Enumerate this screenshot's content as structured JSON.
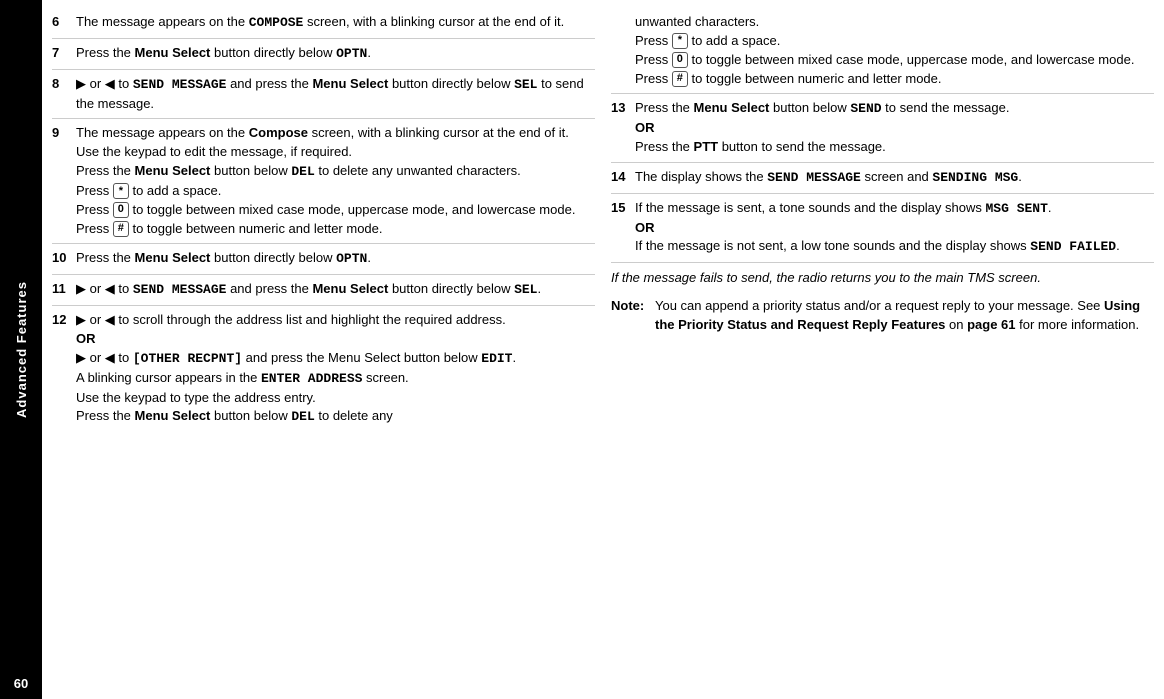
{
  "sidebar": {
    "label": "Advanced Features",
    "page_number": "60"
  },
  "left_column": {
    "steps": [
      {
        "num": "6",
        "parts": [
          {
            "type": "text",
            "content": "The message appears on the "
          },
          {
            "type": "mono",
            "content": "COMPOSE"
          },
          {
            "type": "text",
            "content": " screen, with a blinking cursor at the end of it."
          }
        ]
      },
      {
        "num": "7",
        "parts": [
          {
            "type": "text",
            "content": "Press the "
          },
          {
            "type": "bold",
            "content": "Menu Select"
          },
          {
            "type": "text",
            "content": " button directly below "
          },
          {
            "type": "mono",
            "content": "OPTN"
          },
          {
            "type": "text",
            "content": "."
          }
        ]
      },
      {
        "num": "8",
        "parts": [
          {
            "type": "arrow_or",
            "content": "▶ or ◀"
          },
          {
            "type": "text",
            "content": " to "
          },
          {
            "type": "mono",
            "content": "SEND MESSAGE"
          },
          {
            "type": "text",
            "content": " and press the "
          },
          {
            "type": "bold",
            "content": "Menu Select"
          },
          {
            "type": "text",
            "content": " button directly below "
          },
          {
            "type": "mono",
            "content": "SEL"
          },
          {
            "type": "text",
            "content": " to send the message."
          }
        ]
      },
      {
        "num": "9",
        "multi": true,
        "lines": [
          [
            {
              "type": "text",
              "content": "The message appears on the "
            },
            {
              "type": "bold",
              "content": "Compose"
            },
            {
              "type": "text",
              "content": " screen, with a blinking cursor at the end of it. Use the keypad to edit the message, if required."
            }
          ],
          [
            {
              "type": "text",
              "content": "Press the "
            },
            {
              "type": "bold",
              "content": "Menu Select"
            },
            {
              "type": "text",
              "content": " button below "
            },
            {
              "type": "mono",
              "content": "DEL"
            },
            {
              "type": "text",
              "content": " to delete any unwanted characters."
            }
          ],
          [
            {
              "type": "text",
              "content": "Press "
            },
            {
              "type": "key",
              "content": "*"
            },
            {
              "type": "text",
              "content": " to add a space."
            }
          ],
          [
            {
              "type": "text",
              "content": "Press "
            },
            {
              "type": "key",
              "content": "0"
            },
            {
              "type": "text",
              "content": " to toggle between mixed case mode, uppercase mode, and lowercase mode."
            }
          ],
          [
            {
              "type": "text",
              "content": "Press "
            },
            {
              "type": "key",
              "content": "#"
            },
            {
              "type": "text",
              "content": " to toggle between numeric and letter mode."
            }
          ]
        ]
      },
      {
        "num": "10",
        "parts": [
          {
            "type": "text",
            "content": "Press the "
          },
          {
            "type": "bold",
            "content": "Menu Select"
          },
          {
            "type": "text",
            "content": " button directly below "
          },
          {
            "type": "mono",
            "content": "OPTN"
          },
          {
            "type": "text",
            "content": "."
          }
        ]
      },
      {
        "num": "11",
        "parts": [
          {
            "type": "arrow_or",
            "content": "▶ or ◀"
          },
          {
            "type": "text",
            "content": " to "
          },
          {
            "type": "mono",
            "content": "SEND MESSAGE"
          },
          {
            "type": "text",
            "content": " and press the "
          },
          {
            "type": "bold",
            "content": "Menu Select"
          },
          {
            "type": "text",
            "content": " button directly below "
          },
          {
            "type": "mono",
            "content": "SEL"
          },
          {
            "type": "text",
            "content": "."
          }
        ]
      },
      {
        "num": "12",
        "multi": true,
        "lines": [
          [
            {
              "type": "arrow_or",
              "content": "▶ or ◀"
            },
            {
              "type": "text",
              "content": " to scroll through the address list and highlight the required address."
            }
          ],
          [
            {
              "type": "or",
              "content": "OR"
            }
          ],
          [
            {
              "type": "arrow_or",
              "content": "▶ or ◀"
            },
            {
              "type": "text",
              "content": " to "
            },
            {
              "type": "mono",
              "content": "[OTHER RECPNT]"
            },
            {
              "type": "text",
              "content": " and press the Menu Select button below "
            },
            {
              "type": "mono",
              "content": "EDIT"
            },
            {
              "type": "text",
              "content": "."
            }
          ],
          [
            {
              "type": "text",
              "content": "A blinking cursor appears in the "
            },
            {
              "type": "mono",
              "content": "ENTER ADDRESS"
            },
            {
              "type": "text",
              "content": " screen."
            }
          ],
          [
            {
              "type": "text",
              "content": "Use the keypad to type the address entry."
            }
          ],
          [
            {
              "type": "text",
              "content": "Press the "
            },
            {
              "type": "bold",
              "content": "Menu Select"
            },
            {
              "type": "text",
              "content": " button below "
            },
            {
              "type": "mono",
              "content": "DEL"
            },
            {
              "type": "text",
              "content": " to delete any"
            }
          ]
        ]
      }
    ]
  },
  "right_column": {
    "continuation": {
      "lines": [
        [
          {
            "type": "text",
            "content": "unwanted characters."
          }
        ],
        [
          {
            "type": "text",
            "content": "Press "
          },
          {
            "type": "key",
            "content": "*"
          },
          {
            "type": "text",
            "content": " to add a space."
          }
        ],
        [
          {
            "type": "text",
            "content": "Press "
          },
          {
            "type": "key",
            "content": "0"
          },
          {
            "type": "text",
            "content": " to toggle between mixed case mode, uppercase mode, and lowercase mode."
          }
        ],
        [
          {
            "type": "text",
            "content": "Press "
          },
          {
            "type": "key",
            "content": "#"
          },
          {
            "type": "text",
            "content": " to toggle between numeric and letter mode."
          }
        ]
      ]
    },
    "steps": [
      {
        "num": "13",
        "multi": true,
        "lines": [
          [
            {
              "type": "text",
              "content": "Press the "
            },
            {
              "type": "bold",
              "content": "Menu Select"
            },
            {
              "type": "text",
              "content": " button below "
            },
            {
              "type": "mono",
              "content": "SEND"
            },
            {
              "type": "text",
              "content": " to send the message."
            }
          ],
          [
            {
              "type": "or",
              "content": "OR"
            }
          ],
          [
            {
              "type": "text",
              "content": "Press the "
            },
            {
              "type": "bold",
              "content": "PTT"
            },
            {
              "type": "text",
              "content": " button to send the message."
            }
          ]
        ]
      },
      {
        "num": "14",
        "multi": true,
        "lines": [
          [
            {
              "type": "text",
              "content": "The display shows the "
            },
            {
              "type": "mono",
              "content": "SEND MESSAGE"
            },
            {
              "type": "text",
              "content": " screen and "
            },
            {
              "type": "mono",
              "content": "SENDING MSG"
            },
            {
              "type": "text",
              "content": "."
            }
          ]
        ]
      },
      {
        "num": "15",
        "multi": true,
        "lines": [
          [
            {
              "type": "text",
              "content": "If the message is sent, a tone sounds and the display shows "
            },
            {
              "type": "mono",
              "content": "MSG SENT"
            },
            {
              "type": "text",
              "content": "."
            }
          ],
          [
            {
              "type": "or",
              "content": "OR"
            }
          ],
          [
            {
              "type": "text",
              "content": "If the message is not sent, a low tone sounds and the display shows "
            },
            {
              "type": "mono",
              "content": "SEND FAILED"
            },
            {
              "type": "text",
              "content": "."
            }
          ]
        ]
      }
    ],
    "italic_note": "If the message fails to send, the radio returns you to the main TMS screen.",
    "note": {
      "label": "Note:",
      "content": "You can append a priority status and/or a request reply to your message. See ",
      "bold_content": "Using the Priority Status and Request Reply Features",
      "content2": " on ",
      "bold_content2": "page 61",
      "content3": " for more information."
    }
  }
}
